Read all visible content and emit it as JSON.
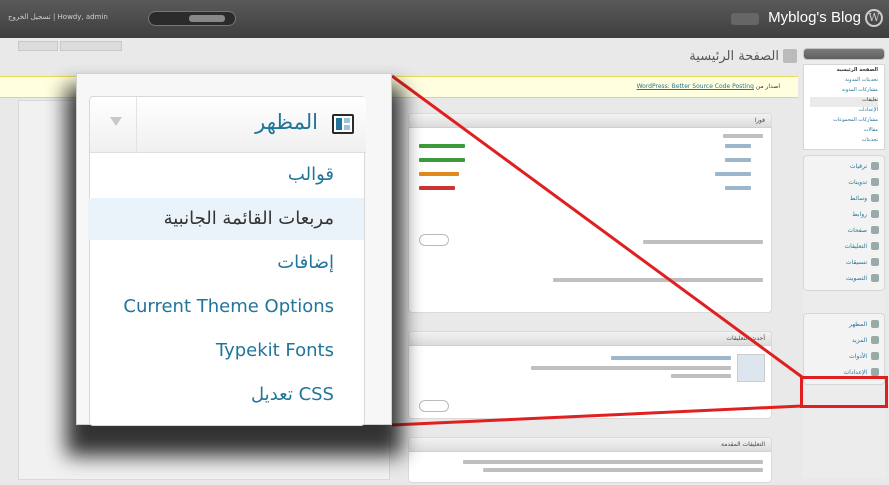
{
  "topbar": {
    "blog_title": "Myblog's Blog",
    "user_links": "تسجيل الخروج | Howdy, admin",
    "quick_links": "Quick links",
    "visit_site": "Visit site"
  },
  "page": {
    "title": "الصفحة الرئيسية",
    "notice_prefix": "اصدار من",
    "notice_link": "WordPress: Better Source Code Posting"
  },
  "sidebar_submenu": [
    "الصفحة الرئيسية",
    "تحديثات المدونة",
    "مشاركات المدونة",
    "تعليقات",
    "الإعدادات",
    "مشاركات المجموعات",
    "مقالات",
    "تحديثات"
  ],
  "sidebar_menu": [
    "ترقيات",
    "تدوينات",
    "وسائط",
    "روابط",
    "صفحات",
    "التعليقات",
    "تنسيقات",
    "التصويت"
  ],
  "sidebar_menu_bottom": [
    "المظهر",
    "المزيد",
    "الأدوات",
    "الإعدادات"
  ],
  "widgets": {
    "right_now_title": "فورا",
    "recent_comments_title": "أحدث التعليقات",
    "incoming_links_title": "التعليقات المقدمة"
  },
  "popup": {
    "title": "المظهر",
    "icon": "appearance-icon",
    "items": [
      "قوالب",
      "مربعات القائمة الجانبية",
      "إضافات",
      "Current Theme Options",
      "Typekit Fonts",
      "تعديل CSS"
    ],
    "current_index": 1
  },
  "colors": {
    "link": "#21759b",
    "highlight": "#e02020",
    "notice_bg": "#ffffe0",
    "topbar": "#464646"
  }
}
